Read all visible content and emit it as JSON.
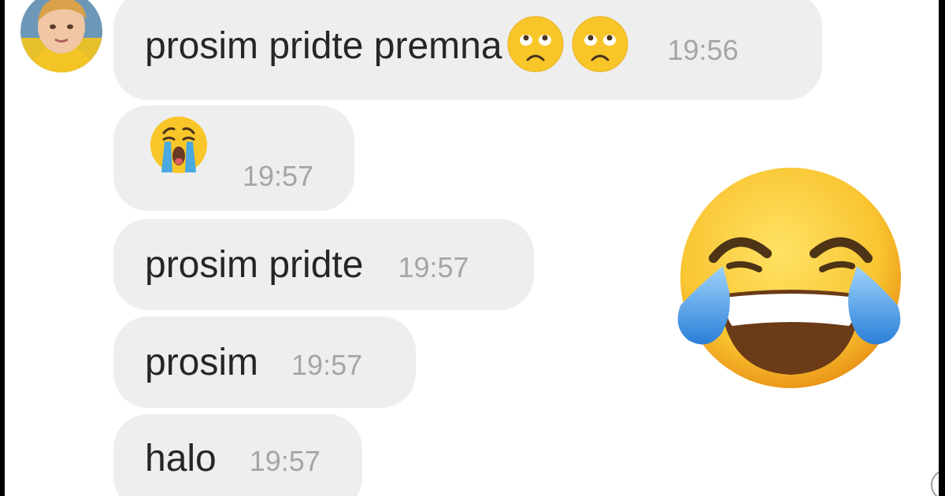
{
  "messages": [
    {
      "text": "prosim pridte premna",
      "time": "19:56",
      "emojis": [
        "sad-face-icon",
        "sad-face-icon"
      ]
    },
    {
      "text": "",
      "time": "19:57",
      "emojis": [
        "crying-face-icon"
      ]
    },
    {
      "text": "prosim pridte",
      "time": "19:57"
    },
    {
      "text": "prosim",
      "time": "19:57"
    },
    {
      "text": "halo",
      "time": "19:57"
    }
  ],
  "overlay": {
    "icon": "tears-of-joy-emoji-icon"
  },
  "colors": {
    "bubble": "#eeeeee",
    "message_text": "#262626",
    "timestamp": "#a5a5a5",
    "emoji_yellow": "#f8c629",
    "tear_blue": "#3c90df"
  }
}
